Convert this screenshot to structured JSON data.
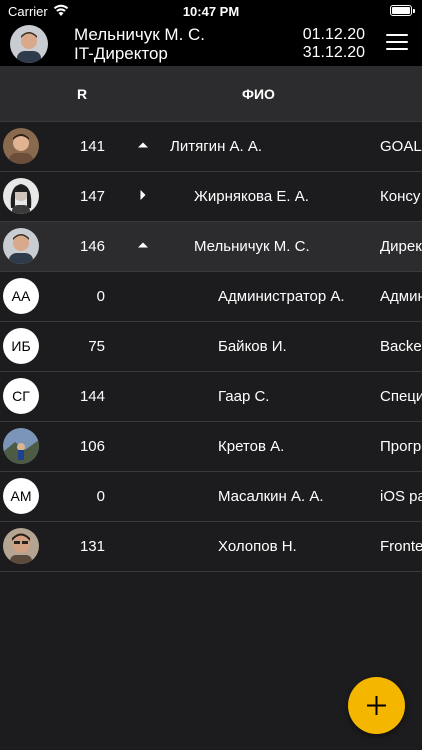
{
  "status_bar": {
    "carrier": "Carrier",
    "time": "10:47 PM",
    "wifi_icon": "wifi-icon",
    "battery_icon": "battery-icon"
  },
  "header": {
    "user_name": "Мельничук М. С.",
    "user_role": "IT-Директор",
    "date_from": "01.12.20",
    "date_to": "31.12.20",
    "menu_icon": "hamburger-menu-icon"
  },
  "table": {
    "columns": {
      "rating": "R",
      "name": "ФИО"
    },
    "rows": [
      {
        "avatar_type": "photo",
        "avatar_initials": "",
        "rating": "141",
        "toggle": "expanded",
        "name": "Литягин А. А.",
        "position": "GOAL",
        "level": 0,
        "selected": false
      },
      {
        "avatar_type": "photo",
        "avatar_initials": "",
        "rating": "147",
        "toggle": "collapsed",
        "name": "Жирнякова Е. А.",
        "position": "Консу",
        "level": 1,
        "selected": false
      },
      {
        "avatar_type": "photo",
        "avatar_initials": "",
        "rating": "146",
        "toggle": "expanded",
        "name": "Мельничук М. С.",
        "position": "Дирек",
        "level": 1,
        "selected": true
      },
      {
        "avatar_type": "initials",
        "avatar_initials": "АА",
        "rating": "0",
        "toggle": "none",
        "name": "Администратор А.",
        "position": "Админ",
        "level": 2,
        "selected": false
      },
      {
        "avatar_type": "initials",
        "avatar_initials": "ИБ",
        "rating": "75",
        "toggle": "none",
        "name": "Байков И.",
        "position": "Backe",
        "level": 2,
        "selected": false
      },
      {
        "avatar_type": "initials",
        "avatar_initials": "СГ",
        "rating": "144",
        "toggle": "none",
        "name": "Гаар С.",
        "position": "Специ",
        "level": 2,
        "selected": false
      },
      {
        "avatar_type": "photo",
        "avatar_initials": "",
        "rating": "106",
        "toggle": "none",
        "name": "Кретов А.",
        "position": "Прогр",
        "level": 2,
        "selected": false
      },
      {
        "avatar_type": "initials",
        "avatar_initials": "АМ",
        "rating": "0",
        "toggle": "none",
        "name": "Масалкин А. А.",
        "position": "iOS ра",
        "level": 2,
        "selected": false
      },
      {
        "avatar_type": "photo",
        "avatar_initials": "",
        "rating": "131",
        "toggle": "none",
        "name": "Холопов Н.",
        "position": "Fronte",
        "level": 2,
        "selected": false
      }
    ]
  },
  "fab": {
    "icon": "plus-icon"
  },
  "colors": {
    "background": "#1c1c1e",
    "header_bg": "#000000",
    "selected_row": "#2c2c2e",
    "accent": "#f5b600"
  }
}
